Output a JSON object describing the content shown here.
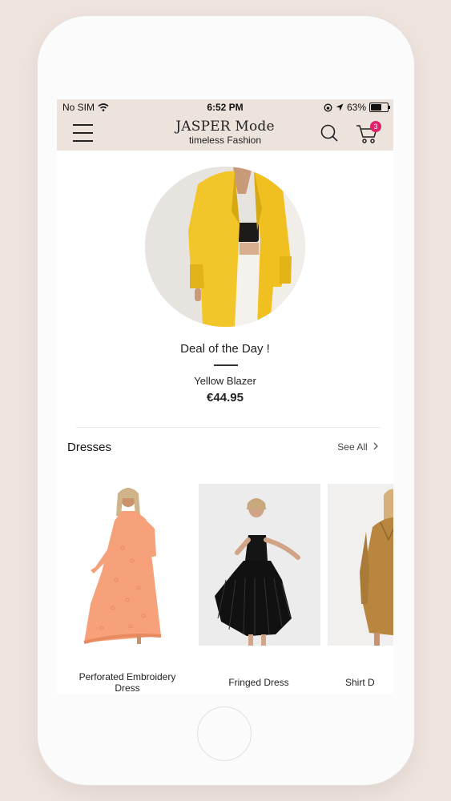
{
  "status_bar": {
    "carrier": "No SIM",
    "time": "6:52 PM",
    "battery_percent": "63%"
  },
  "header": {
    "brand_name": "JASPER Mode",
    "tagline": "timeless Fashion",
    "cart_count": "3",
    "icons": [
      "menu-icon",
      "search-icon",
      "cart-icon"
    ]
  },
  "deal": {
    "title": "Deal of the Day !",
    "product_name": "Yellow Blazer",
    "price": "€44.95"
  },
  "dresses_section": {
    "title": "Dresses",
    "see_all": "See All",
    "products": [
      {
        "name": "Perforated Embroidery Dress"
      },
      {
        "name": "Fringed Dress"
      },
      {
        "name": "Shirt D"
      }
    ]
  },
  "colors": {
    "header_bg": "#ede3dd",
    "badge": "#e0216a",
    "page_bg": "#efe3dd"
  }
}
